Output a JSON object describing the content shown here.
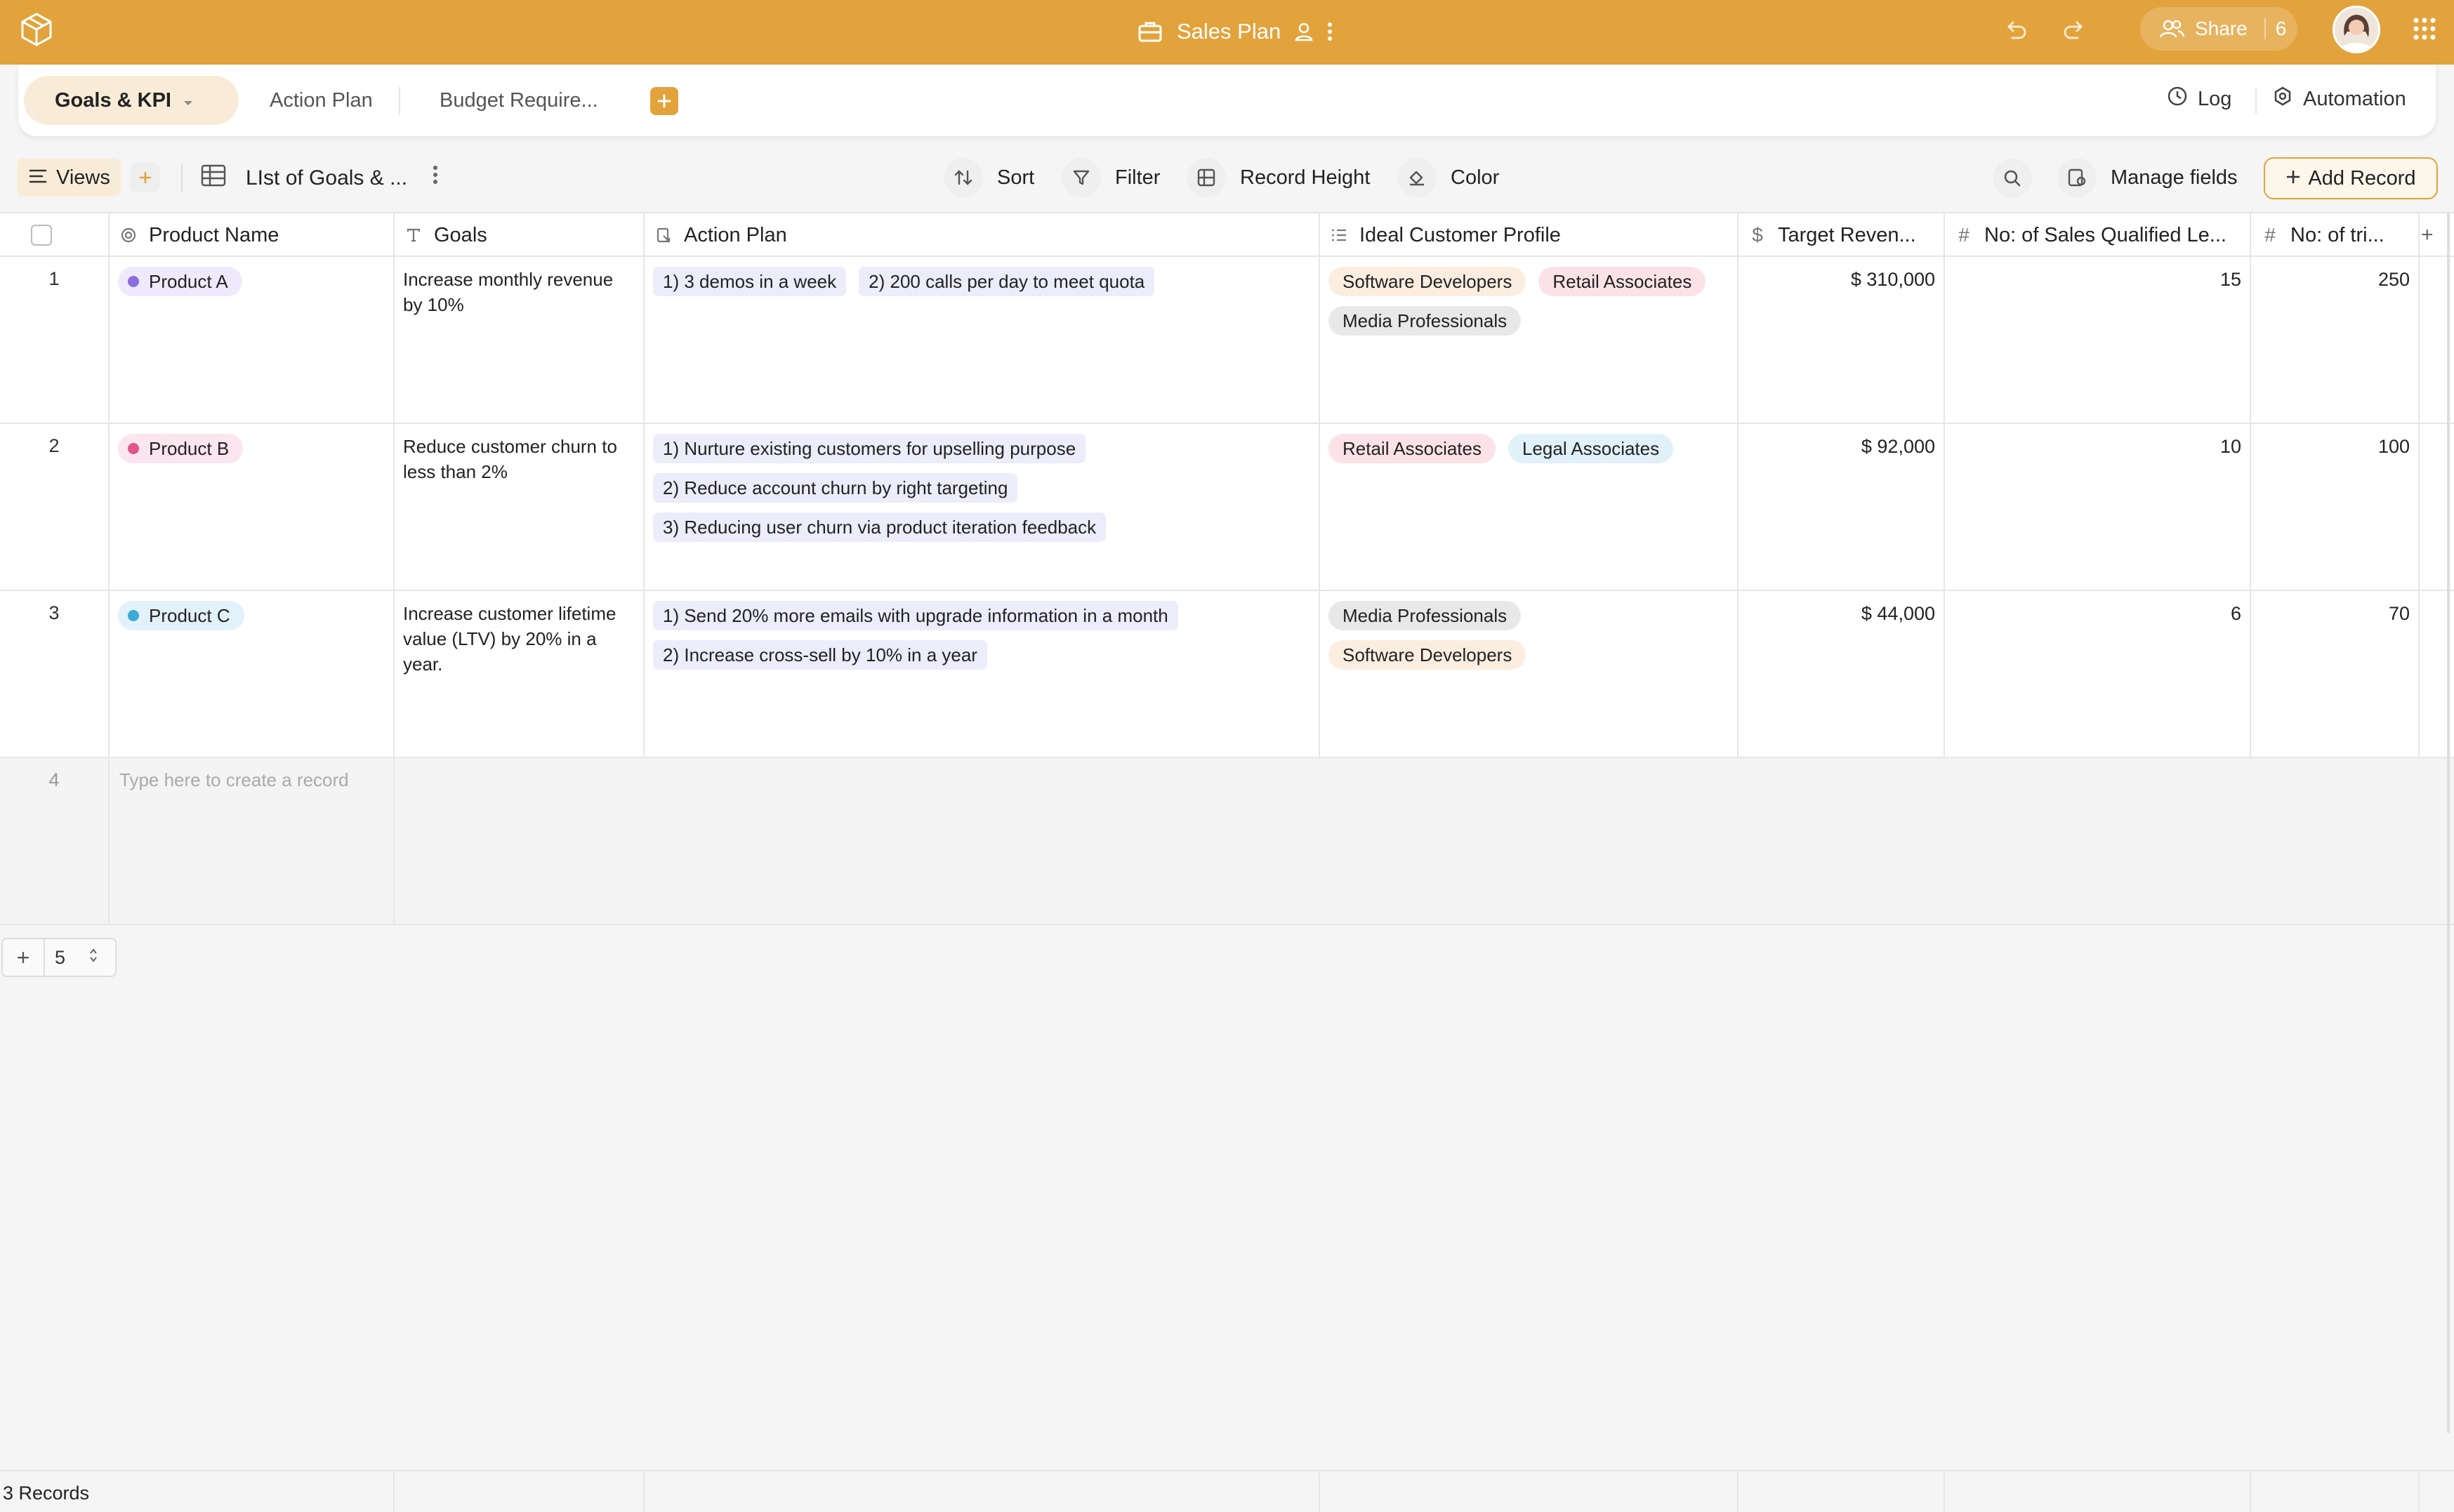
{
  "header": {
    "doc_title": "Sales Plan",
    "share_label": "Share",
    "share_count": "6"
  },
  "tabs": {
    "items": [
      {
        "label": "Goals & KPI"
      },
      {
        "label": "Action Plan"
      },
      {
        "label": "Budget Require..."
      }
    ],
    "log_label": "Log",
    "automation_label": "Automation"
  },
  "toolbar": {
    "views_label": "Views",
    "view_name": "LIst of Goals & ...",
    "sort_label": "Sort",
    "filter_label": "Filter",
    "record_height_label": "Record Height",
    "color_label": "Color",
    "manage_fields_label": "Manage fields",
    "add_record_label": "Add Record"
  },
  "columns": [
    {
      "label": "Product Name",
      "icon": "primary-field-icon"
    },
    {
      "label": "Goals",
      "icon": "text-field-icon"
    },
    {
      "label": "Action Plan",
      "icon": "link-field-icon"
    },
    {
      "label": "Ideal Customer Profile",
      "icon": "multi-select-icon"
    },
    {
      "label": "Target Reven...",
      "icon": "currency-icon"
    },
    {
      "label": "No: of Sales Qualified Le...",
      "icon": "number-icon"
    },
    {
      "label": "No: of tri...",
      "icon": "number-icon"
    }
  ],
  "rows": [
    {
      "num": "1",
      "product": "Product A",
      "product_color": "#8b6fe0",
      "product_bg": "#efeafb",
      "goal": "Increase monthly revenue by 10%",
      "actions": [
        "1) 3 demos in a week",
        "2) 200 calls per day to meet quota"
      ],
      "profiles": [
        {
          "label": "Software Developers",
          "kind": "dev"
        },
        {
          "label": "Retail Associates",
          "kind": "retail"
        },
        {
          "label": "Media Professionals",
          "kind": "media"
        }
      ],
      "target_revenue": "$ 310,000",
      "sql": "15",
      "trials": "250"
    },
    {
      "num": "2",
      "product": "Product B",
      "product_color": "#e0558a",
      "product_bg": "#fbe5ee",
      "goal": "Reduce customer churn to less than 2%",
      "actions": [
        "1) Nurture existing customers for upselling purpose",
        "2) Reduce account churn by right targeting",
        "3) Reducing user churn via product iteration feedback"
      ],
      "profiles": [
        {
          "label": "Retail Associates",
          "kind": "retail"
        },
        {
          "label": "Legal Associates",
          "kind": "legal"
        }
      ],
      "target_revenue": "$ 92,000",
      "sql": "10",
      "trials": "100"
    },
    {
      "num": "3",
      "product": "Product C",
      "product_color": "#3aa9d8",
      "product_bg": "#e2f1fa",
      "goal": "Increase customer lifetime value (LTV) by 20% in a year.",
      "actions": [
        "1) Send 20% more emails with upgrade information in a month",
        "2) Increase cross-sell by 10% in a year"
      ],
      "profiles": [
        {
          "label": "Media Professionals",
          "kind": "media"
        },
        {
          "label": "Software Developers",
          "kind": "dev"
        }
      ],
      "target_revenue": "$ 44,000",
      "sql": "6",
      "trials": "70"
    }
  ],
  "new_row": {
    "num": "4",
    "placeholder": "Type here to create a record"
  },
  "add_rows_value": "5",
  "footer": {
    "record_count": "3 Records"
  },
  "colors": {
    "brand": "#e2a33c",
    "active_tab_bg": "#f8ecd8"
  }
}
